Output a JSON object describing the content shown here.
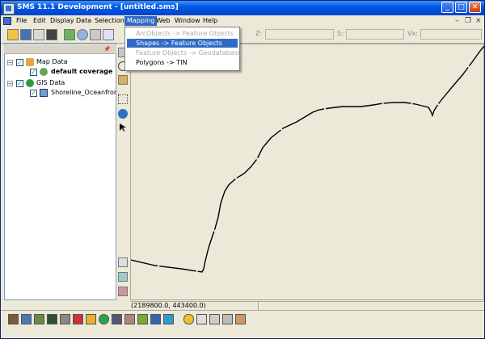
{
  "window": {
    "title": "SMS 11.1 Development - [untitled.sms]",
    "controls": {
      "minimize": "_",
      "maximize": "□",
      "close": "✕"
    }
  },
  "menu": {
    "items": [
      "File",
      "Edit",
      "Display",
      "Data",
      "Selection",
      "Mapping",
      "Web",
      "Window",
      "Help"
    ],
    "active": "Mapping",
    "mdi_controls": {
      "minimize": "–",
      "restore": "❐",
      "close": "×"
    }
  },
  "mapping_menu": {
    "items": [
      {
        "label": "ArcObjects -> Feature Objects",
        "state": "disabled"
      },
      {
        "label": "Shapes -> Feature Objects",
        "state": "highlighted"
      },
      {
        "label": "Feature Objects -> Geodatabase",
        "state": "disabled"
      },
      {
        "label": "Polygons -> TIN",
        "state": "enabled"
      }
    ]
  },
  "toolbar": {
    "coord_labels": {
      "z": "Z:",
      "s": "S:",
      "vx": "Vx:"
    }
  },
  "tree": {
    "items": [
      {
        "label": "Map Data",
        "icon": "map-data-icon",
        "checked": true,
        "expanded": true
      },
      {
        "label": "default coverage",
        "icon": "coverage-icon",
        "checked": true,
        "bold": true
      },
      {
        "label": "GIS Data",
        "icon": "globe-icon",
        "checked": true,
        "expanded": true
      },
      {
        "label": "Shoreline_Oceanfront",
        "icon": "shapefile-icon",
        "checked": true
      }
    ],
    "check_glyph": "✓",
    "expander_glyph": "−"
  },
  "status": {
    "coordinates": "(2189800.0, 443400.0)"
  },
  "colors": {
    "title_bar": "#0054e3",
    "menu_highlight": "#316ac5",
    "chrome": "#ece9d8",
    "shoreline": "#000000"
  },
  "icons": {
    "palette": [
      "pan-icon",
      "rotate-icon",
      "zoom-icon",
      "select-icon",
      "info-icon",
      "arrow-icon"
    ],
    "bottom": [
      "create-feature-icon",
      "node-icon",
      "vertex-icon",
      "arc-icon",
      "polygon-icon",
      "info-icon"
    ]
  }
}
